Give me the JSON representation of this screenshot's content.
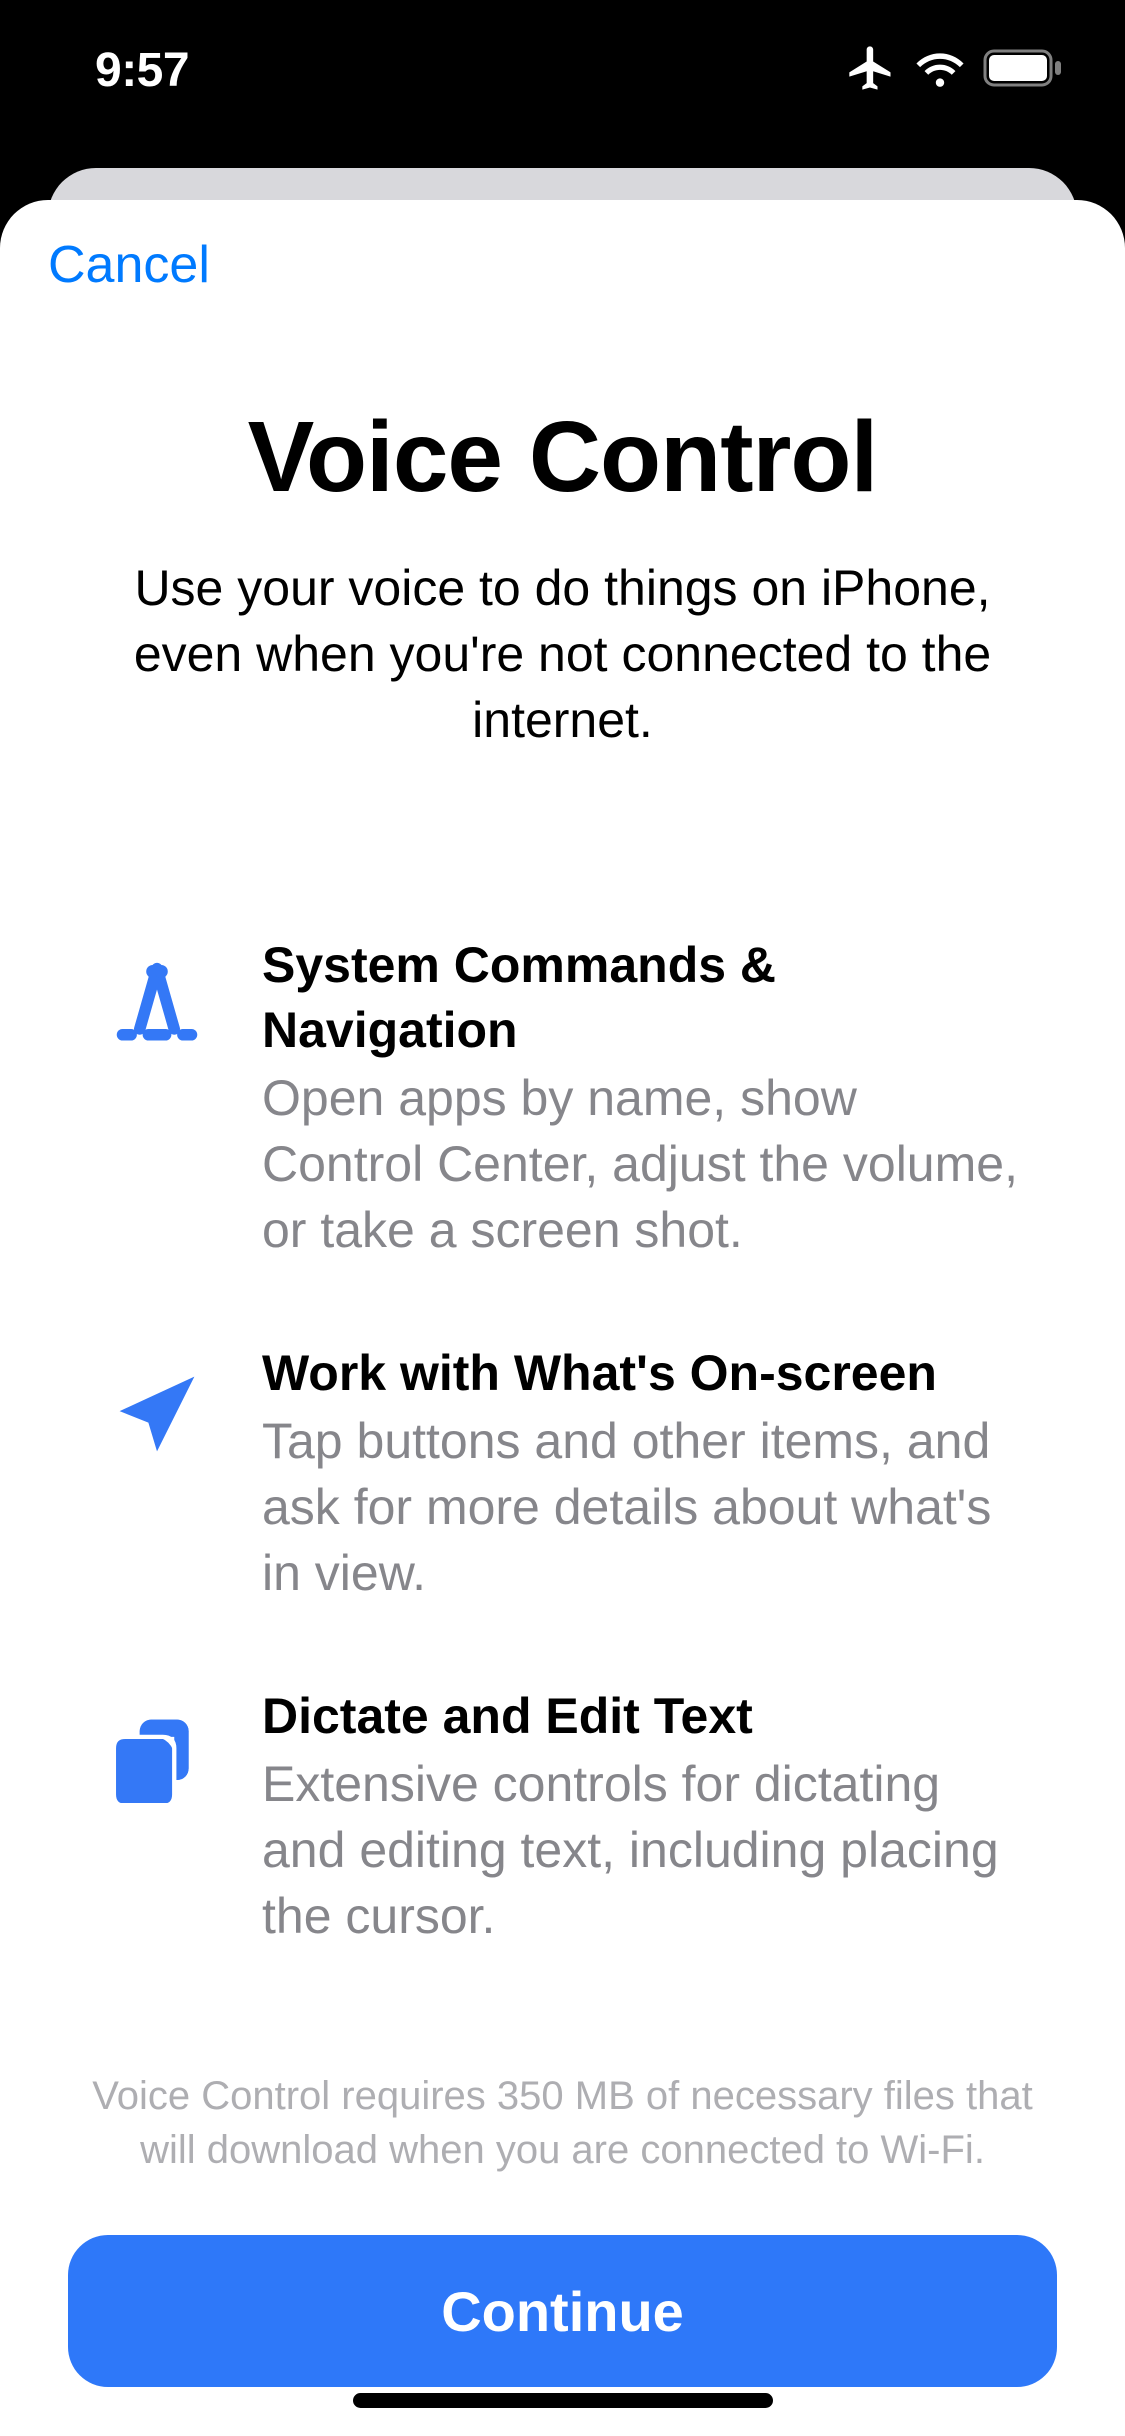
{
  "statusBar": {
    "time": "9:57"
  },
  "nav": {
    "cancel": "Cancel"
  },
  "main": {
    "title": "Voice Control",
    "subtitle": "Use your voice to do things on iPhone, even when you're not connected to the internet."
  },
  "features": [
    {
      "title": "System Commands & Navigation",
      "desc": "Open apps by name, show Control Center, adjust the volume, or take a screen shot."
    },
    {
      "title": "Work with What's On-screen",
      "desc": "Tap buttons and other items, and ask for more details about what's in view."
    },
    {
      "title": "Dictate and Edit Text",
      "desc": "Extensive controls for dictating and editing text, including placing the cursor."
    }
  ],
  "note": "Voice Control requires 350 MB of necessary files that will download when you are connected to Wi-Fi.",
  "actions": {
    "continue": "Continue"
  }
}
